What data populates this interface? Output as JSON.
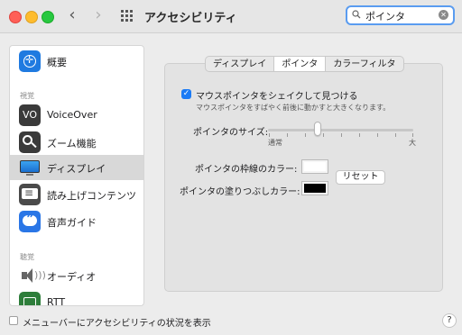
{
  "window": {
    "title": "アクセシビリティ",
    "nav": {
      "back": "‹",
      "forward": "›"
    }
  },
  "search": {
    "value": "ポインタ",
    "clear": "✕"
  },
  "sidebar": {
    "items": [
      {
        "label": "概要",
        "icon": "accessibility-icon"
      },
      {
        "header": "視覚"
      },
      {
        "label": "VoiceOver",
        "icon": "voiceover-icon",
        "icon_text": "VO"
      },
      {
        "label": "ズーム機能",
        "icon": "zoom-icon"
      },
      {
        "label": "ディスプレイ",
        "icon": "display-icon",
        "selected": true
      },
      {
        "label": "読み上げコンテンツ",
        "icon": "spoken-content-icon"
      },
      {
        "label": "音声ガイド",
        "icon": "descriptions-icon"
      },
      {
        "header": "聴覚"
      },
      {
        "label": "オーディオ",
        "icon": "audio-icon"
      },
      {
        "label": "RTT",
        "icon": "rtt-icon"
      }
    ]
  },
  "tabs": [
    {
      "label": "ディスプレイ",
      "active": false
    },
    {
      "label": "ポインタ",
      "active": true
    },
    {
      "label": "カラーフィルタ",
      "active": false
    }
  ],
  "pointer": {
    "shake_checkbox_checked": true,
    "shake_label": "マウスポインタをシェイクして見つける",
    "shake_desc": "マウスポインタをすばやく前後に動かすと大きくなります。",
    "size_label": "ポインタのサイズ:",
    "size_min_label": "通常",
    "size_max_label": "大",
    "size_value": 0.34,
    "outline_label": "ポインタの枠線のカラー:",
    "outline_color": "#ffffff",
    "fill_label": "ポインタの塗りつぶしカラー:",
    "fill_color": "#000000",
    "reset_label": "リセット"
  },
  "footer": {
    "menubar_checkbox_checked": false,
    "menubar_label": "メニューバーにアクセシビリティの状況を表示",
    "help_label": "?"
  },
  "colors": {
    "accent": "#1b7bf5",
    "selected_row": "#d8d8d8"
  }
}
